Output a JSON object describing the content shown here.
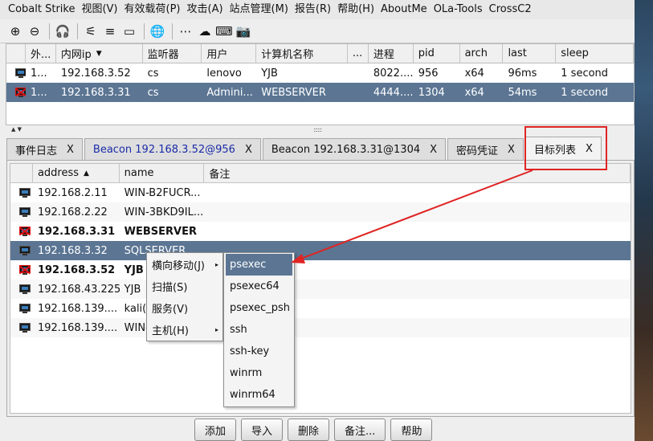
{
  "menu": [
    "Cobalt Strike",
    "视图(V)",
    "有效载荷(P)",
    "攻击(A)",
    "站点管理(M)",
    "报告(R)",
    "帮助(H)",
    "AboutMe",
    "OLa-Tools",
    "CrossC2"
  ],
  "toolbar": [
    {
      "icon": "connect-icon",
      "glyph": "⊕"
    },
    {
      "icon": "disconnect-icon",
      "glyph": "⊖"
    },
    {
      "icon": "headphones-icon",
      "glyph": "🎧"
    },
    {
      "icon": "share-icon",
      "glyph": "⚟"
    },
    {
      "icon": "list-icon",
      "glyph": "≡"
    },
    {
      "icon": "monitor-icon",
      "glyph": "▭"
    },
    {
      "icon": "globe-icon",
      "glyph": "🌐"
    },
    {
      "icon": "dots-icon",
      "glyph": "⋯"
    },
    {
      "icon": "cloud-download-icon",
      "glyph": "☁"
    },
    {
      "icon": "keyboard-icon",
      "glyph": "⌨"
    },
    {
      "icon": "camera-icon",
      "glyph": "📷"
    }
  ],
  "sessions": {
    "columns": [
      "",
      "外...",
      "内网ip",
      "监听器",
      "用户",
      "计算机名称",
      "...",
      "进程",
      "pid",
      "arch",
      "last",
      "sleep"
    ],
    "sort_indicator": "▼",
    "rows": [
      {
        "ext": "1...",
        "ip": "192.168.3.52",
        "listener": "cs",
        "user": "lenovo",
        "computer": "YJB",
        "note": "",
        "process": "8022....",
        "pid": "956",
        "arch": "x64",
        "last": "96ms",
        "sleep": "1 second"
      },
      {
        "ext": "1...",
        "ip": "192.168.3.31",
        "listener": "cs",
        "user": "Admini...",
        "computer": "WEBSERVER",
        "note": "",
        "process": "4444....",
        "pid": "1304",
        "arch": "x64",
        "last": "54ms",
        "sleep": "1 second"
      }
    ]
  },
  "tabs": [
    {
      "label": "事件日志",
      "close": "X"
    },
    {
      "label": "Beacon 192.168.3.52@956",
      "close": "X"
    },
    {
      "label": "Beacon 192.168.3.31@1304",
      "close": "X"
    },
    {
      "label": "密码凭证",
      "close": "X"
    },
    {
      "label": "目标列表",
      "close": "X"
    }
  ],
  "targets": {
    "columns": [
      "",
      "address",
      "name",
      "备注"
    ],
    "sort_indicator": "▲",
    "rows": [
      {
        "address": "192.168.2.11",
        "name": "WIN-B2FUCR..."
      },
      {
        "address": "192.168.2.22",
        "name": "WIN-3BKD9IL..."
      },
      {
        "address": "192.168.3.31",
        "name": "WEBSERVER"
      },
      {
        "address": "192.168.3.32",
        "name": "SQLSERVER"
      },
      {
        "address": "192.168.3.52",
        "name": "YJB"
      },
      {
        "address": "192.168.43.225",
        "name": "YJB"
      },
      {
        "address": "192.168.139....",
        "name": "kali(4"
      },
      {
        "address": "192.168.139....",
        "name": "WIN-"
      }
    ]
  },
  "context_menu": {
    "items": [
      {
        "label": "横向移动(J)",
        "arrow": "▸"
      },
      {
        "label": "扫描(S)",
        "arrow": ""
      },
      {
        "label": "服务(V)",
        "arrow": ""
      },
      {
        "label": "主机(H)",
        "arrow": "▸"
      }
    ],
    "submenu": [
      "psexec",
      "psexec64",
      "psexec_psh",
      "ssh",
      "ssh-key",
      "winrm",
      "winrm64"
    ]
  },
  "buttons": [
    "添加",
    "导入",
    "删除",
    "备注...",
    "帮助"
  ],
  "colors": {
    "selection": "#5b7593",
    "annotation": "#e02424"
  }
}
